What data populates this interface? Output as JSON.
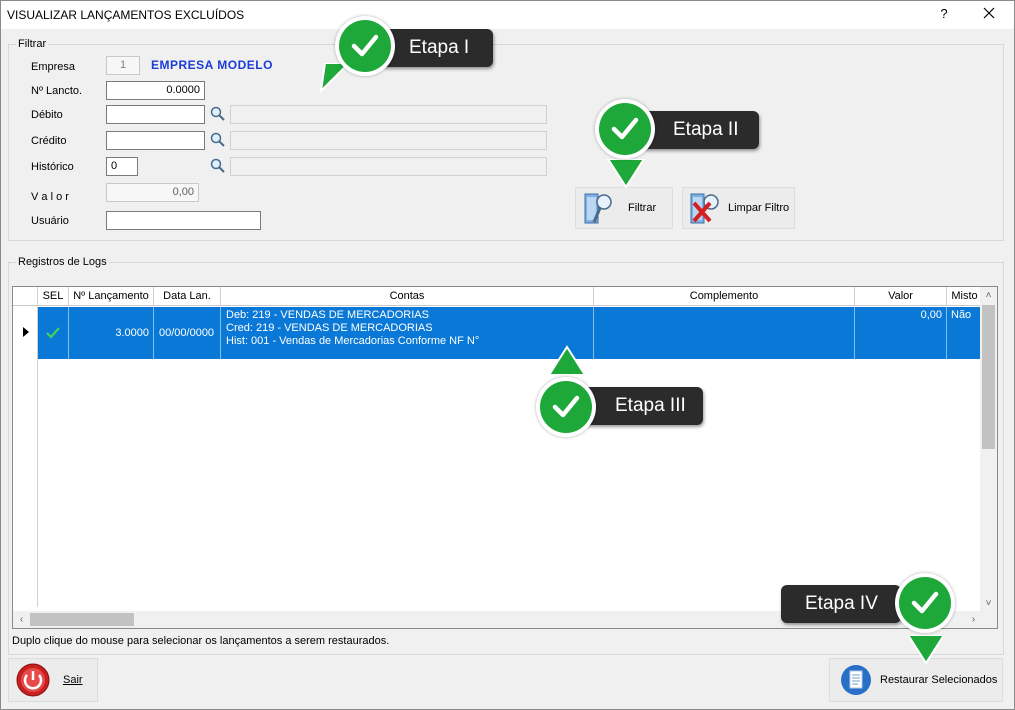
{
  "window": {
    "title": "VISUALIZAR LANÇAMENTOS EXCLUÍDOS",
    "help": "?"
  },
  "filter": {
    "group_title": "Filtrar",
    "empresa_label": "Empresa",
    "empresa_code": "1",
    "empresa_name": "EMPRESA MODELO",
    "lancto_label": "Nº Lancto.",
    "lancto_value": "0.0000",
    "debito_label": "Débito",
    "debito_value": "",
    "credito_label": "Crédito",
    "credito_value": "",
    "historico_label": "Histórico",
    "historico_value": "0",
    "valor_label": "V a l o r",
    "valor_value": "0,00",
    "usuario_label": "Usuário",
    "usuario_value": "",
    "filtrar_label": "Filtrar",
    "limpar_label": "Limpar Filtro"
  },
  "logs": {
    "group_title": "Registros de Logs",
    "columns": [
      "SEL",
      "Nº Lançamento",
      "Data Lan.",
      "Contas",
      "Complemento",
      "Valor",
      "Misto"
    ],
    "rows": [
      {
        "sel": true,
        "lancamento": "3.0000",
        "data": "00/00/0000",
        "contas": [
          "Deb: 219 - VENDAS DE MERCADORIAS",
          "Cred: 219 - VENDAS DE MERCADORIAS",
          "Hist: 001 - Vendas de Mercadorias Conforme NF N°"
        ],
        "complemento": "",
        "valor": "0,00",
        "misto": "Não"
      }
    ]
  },
  "hint": "Duplo clique do mouse para selecionar os lançamentos a serem restaurados.",
  "footer": {
    "sair_label": "Sair",
    "restaurar_label": "Restaurar Selecionados"
  },
  "callouts": {
    "step1": "Etapa I",
    "step2": "Etapa II",
    "step3": "Etapa III",
    "step4": "Etapa IV"
  },
  "colors": {
    "accent": "#1ea83a",
    "selection": "#0a78d7",
    "company": "#1a3cd8",
    "callout_bg": "#2b2b2b"
  }
}
